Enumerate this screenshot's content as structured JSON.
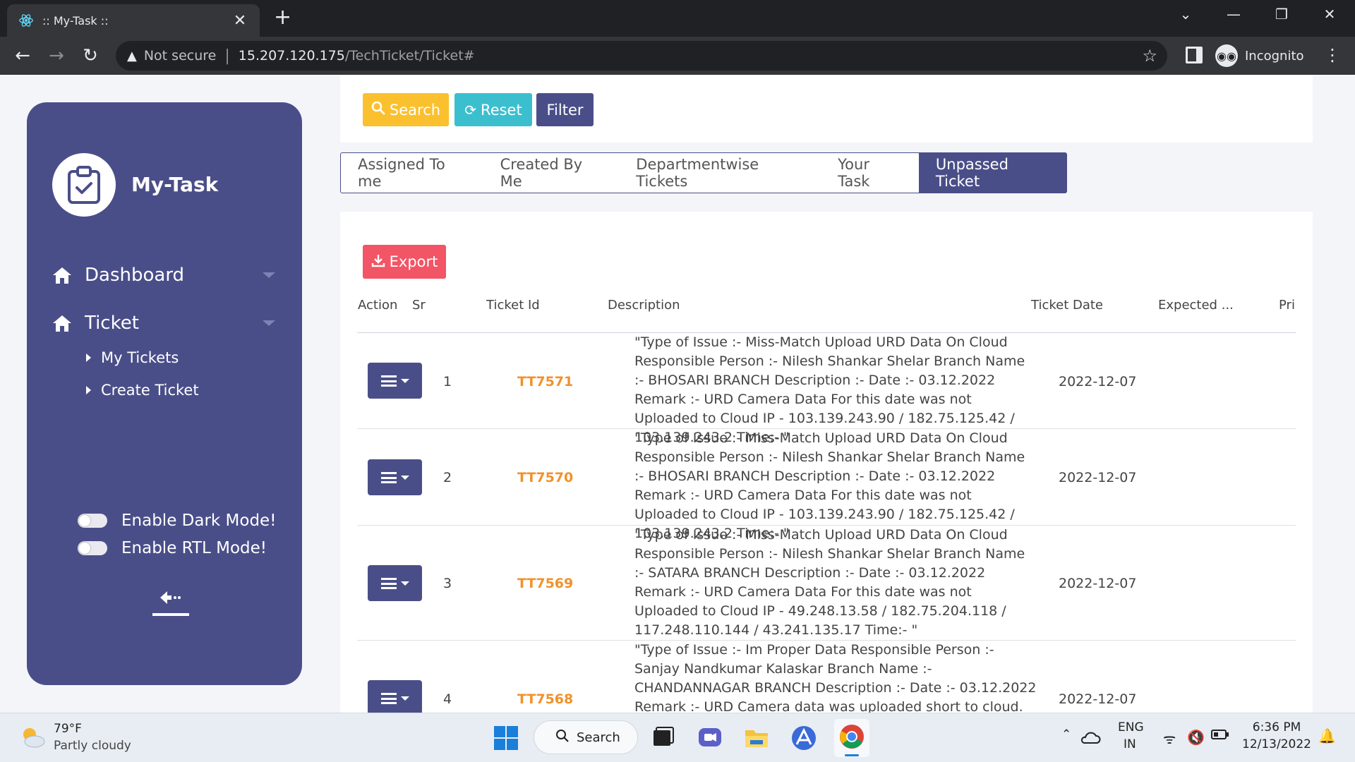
{
  "browser": {
    "tab_title": ":: My-Task ::",
    "new_tab": "+",
    "not_secure": "Not secure",
    "url_host": "15.207.120.175",
    "url_path": "/TechTicket/Ticket#",
    "incognito_label": "Incognito"
  },
  "sidebar": {
    "brand": "My-Task",
    "menu": [
      {
        "label": "Dashboard"
      },
      {
        "label": "Ticket"
      }
    ],
    "submenu": [
      {
        "label": "My Tickets"
      },
      {
        "label": "Create Ticket"
      }
    ],
    "toggles": [
      {
        "label": "Enable Dark Mode!"
      },
      {
        "label": "Enable RTL Mode!"
      }
    ]
  },
  "toolbar": {
    "search_label": "Search",
    "reset_label": "Reset",
    "filter_label": "Filter",
    "export_label": "Export"
  },
  "tabs": [
    "Assigned To me",
    "Created By Me",
    "Departmentwise Tickets",
    "Your Task",
    "Unpassed Ticket"
  ],
  "table": {
    "headers": [
      "Action",
      "Sr",
      "Ticket Id",
      "Description",
      "Ticket Date",
      "Expected ...",
      "Pri"
    ],
    "rows": [
      {
        "sr": "1",
        "ticket_id": "TT7571",
        "description": "\"Type of Issue :- Miss-Match Upload URD Data On Cloud Responsible Person :- Nilesh Shankar Shelar Branch Name :- BHOSARI BRANCH Description :- Date :- 03.12.2022 Remark :- URD Camera Data For this date was not Uploaded to Cloud IP - 103.139.243.90 / 182.75.125.42 / 103.139.243.2 Time:- \"",
        "ticket_date": "2022-12-07"
      },
      {
        "sr": "2",
        "ticket_id": "TT7570",
        "description": "\"Type of Issue :- Miss-Match Upload URD Data On Cloud Responsible Person :- Nilesh Shankar Shelar Branch Name :- BHOSARI BRANCH Description :- Date :- 03.12.2022 Remark :- URD Camera Data For this date was not Uploaded to Cloud IP - 103.139.243.90 / 182.75.125.42 / 103.139.243.2 Time:- \"",
        "ticket_date": "2022-12-07"
      },
      {
        "sr": "3",
        "ticket_id": "TT7569",
        "description": "\"Type of Issue :- Miss-Match Upload URD Data On Cloud Responsible Person :- Nilesh Shankar Shelar Branch Name :- SATARA BRANCH Description :- Date :- 03.12.2022 Remark :- URD Camera Data For this date was not Uploaded to Cloud IP - 49.248.13.58 / 182.75.204.118 / 117.248.110.144 / 43.241.135.17 Time:- \"",
        "ticket_date": "2022-12-07"
      },
      {
        "sr": "4",
        "ticket_id": "TT7568",
        "description": "\"Type of Issue :- Im Proper Data Responsible Person :- Sanjay Nandkumar Kalaskar Branch Name :- CHANDANNAGAR BRANCH Description :- Date :- 03.12.2022 Remark :- URD Camera data was uploaded short to cloud. IP",
        "ticket_date": "2022-12-07"
      }
    ]
  },
  "taskbar": {
    "temperature": "79°F",
    "weather": "Partly cloudy",
    "search_label": "Search",
    "lang": "ENG",
    "region": "IN",
    "time": "6:36 PM",
    "date": "12/13/2022"
  },
  "colors": {
    "sidebar": "#4a4e88",
    "search": "#fbc02d",
    "reset": "#3bbfcf",
    "export": "#f25565",
    "ticket_id": "#f0922b"
  }
}
